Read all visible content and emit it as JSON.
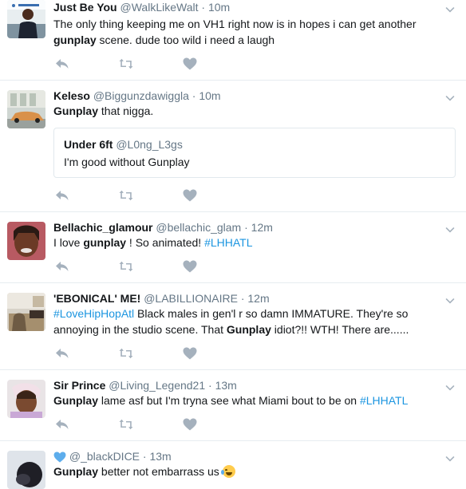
{
  "tweets": [
    {
      "name": "Just Be You",
      "handle": "@WalkLikeWalt",
      "time": "10m",
      "text_before": "The only thing keeping me on VH1 right now is in hopes i can get another",
      "bold": "gunplay",
      "text_after": " scene. dude too wild i need a laugh"
    },
    {
      "name": "Keleso",
      "handle": "@Biggunzdawiggla",
      "time": "10m",
      "bold": "Gunplay",
      "text_after": " that nigga.",
      "quote": {
        "name": "Under 6ft",
        "handle": "@L0ng_L3gs",
        "text": "I'm good without Gunplay"
      }
    },
    {
      "name": "Bellachic_glamour",
      "handle": "@bellachic_glam",
      "time": "12m",
      "text_before": "I love ",
      "bold": "gunplay",
      "text_after": " ! So animated! ",
      "hashtag": "#LHHATL"
    },
    {
      "name": "'EBONICAL' ME!",
      "handle": "@LABILLIONAIRE",
      "time": "12m",
      "hashtag": "#LoveHipHopAtl",
      "line1_after": " Black males in gen'l r so damn IMMATURE. They're so",
      "line2_before": "annoying in the studio scene. That ",
      "bold": "Gunplay",
      "line2_after": " idiot?!!  WTH! There are......"
    },
    {
      "name": "Sir Prince",
      "handle": "@Living_Legend21",
      "time": "13m",
      "bold": "Gunplay",
      "text_after": " lame asf but I'm tryna see what Miami bout to be on ",
      "hashtag": "#LHHATL"
    },
    {
      "name": "",
      "handle": "@_blackDICE",
      "time": "13m",
      "bold": "Gunplay",
      "text_after": " better not embarrass us "
    }
  ],
  "separator": "·",
  "icons": {
    "reply": "reply-icon",
    "retweet": "retweet-icon",
    "like": "heart-icon",
    "more": "chevron-down-icon",
    "name_emoji": "blue-heart-icon",
    "text_emoji": "tears-of-joy-emoji"
  },
  "colors": {
    "text": "#14171a",
    "secondary": "#657786",
    "link": "#1b95e0",
    "icon": "#a5b1bd",
    "border": "#e6ecf0"
  }
}
